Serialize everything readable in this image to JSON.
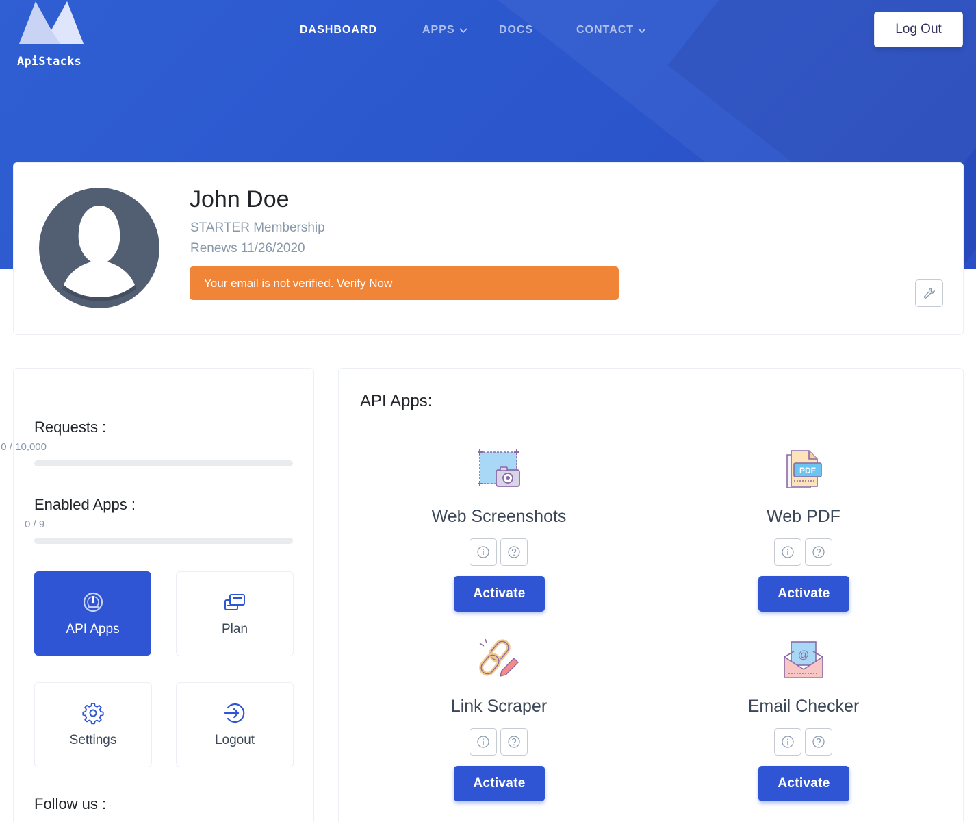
{
  "brand": {
    "name": "ApiStacks"
  },
  "nav": {
    "items": [
      {
        "label": "DASHBOARD",
        "active": true,
        "dropdown": false
      },
      {
        "label": "APPS",
        "active": false,
        "dropdown": true
      },
      {
        "label": "DOCS",
        "active": false,
        "dropdown": false
      },
      {
        "label": "CONTACT",
        "active": false,
        "dropdown": true
      }
    ],
    "logout_label": "Log Out"
  },
  "profile": {
    "name": "John Doe",
    "membership": "STARTER Membership",
    "renews": "Renews 11/26/2020",
    "alert": "Your email is not verified. Verify Now",
    "alert_color": "#f08437",
    "edit_icon": "wrench-icon"
  },
  "sidebar": {
    "requests_label": "Requests :",
    "requests_value": "0 / 10,000",
    "requests_progress": 0,
    "enabled_label": "Enabled Apps :",
    "enabled_value": "0 / 9",
    "enabled_progress": 0,
    "tiles": [
      {
        "label": "API Apps",
        "icon": "dashboard-gauge-icon",
        "active": true
      },
      {
        "label": "Plan",
        "icon": "plan-cards-icon",
        "active": false
      },
      {
        "label": "Settings",
        "icon": "gear-icon",
        "active": false
      },
      {
        "label": "Logout",
        "icon": "logout-icon",
        "active": false
      }
    ],
    "follow_label": "Follow us :"
  },
  "apps": {
    "title": "API Apps:",
    "items": [
      {
        "name": "Web Screenshots",
        "icon": "screenshot-camera-icon",
        "activate_label": "Activate"
      },
      {
        "name": "Web PDF",
        "icon": "pdf-document-icon",
        "activate_label": "Activate"
      },
      {
        "name": "Link Scraper",
        "icon": "chain-link-pencil-icon",
        "activate_label": "Activate"
      },
      {
        "name": "Email Checker",
        "icon": "email-envelope-icon",
        "activate_label": "Activate"
      }
    ]
  },
  "colors": {
    "primary": "#2f55d4",
    "hero": "#2b56cc",
    "warning": "#f08437",
    "muted": "#8898aa"
  }
}
